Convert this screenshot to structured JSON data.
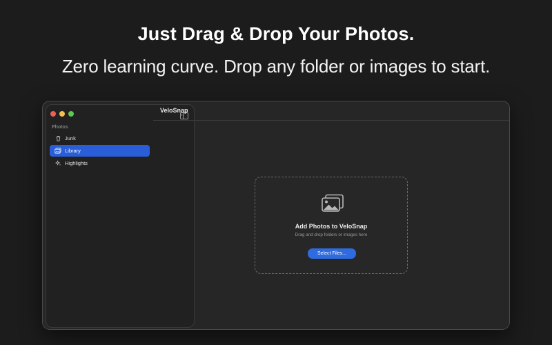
{
  "hero": {
    "headline": "Just Drag & Drop Your Photos.",
    "subline": "Zero learning curve. Drop any folder or images to start."
  },
  "window": {
    "title": "VeloSnap",
    "controls": [
      "close",
      "minimize",
      "zoom"
    ],
    "sidebar_toggle_icon": "sidebar-toggle-icon"
  },
  "sidebar": {
    "section_label": "Photos",
    "items": [
      {
        "label": "Junk",
        "icon": "trash-icon",
        "active": false
      },
      {
        "label": "Library",
        "icon": "photo-library-icon",
        "active": true
      },
      {
        "label": "Highlights",
        "icon": "sparkle-icon",
        "active": false
      }
    ]
  },
  "dropzone": {
    "icon": "photos-stack-icon",
    "title": "Add Photos to VeloSnap",
    "subtitle": "Drag and drop folders or images here",
    "button_label": "Select Files..."
  },
  "colors": {
    "background": "#1c1c1c",
    "window": "#262626",
    "sidebar": "#212121",
    "accent": "#2a5ed8",
    "button": "#2e6be0",
    "traffic_red": "#ee5f57",
    "traffic_yellow": "#f4bf4f",
    "traffic_green": "#5dc94f"
  }
}
